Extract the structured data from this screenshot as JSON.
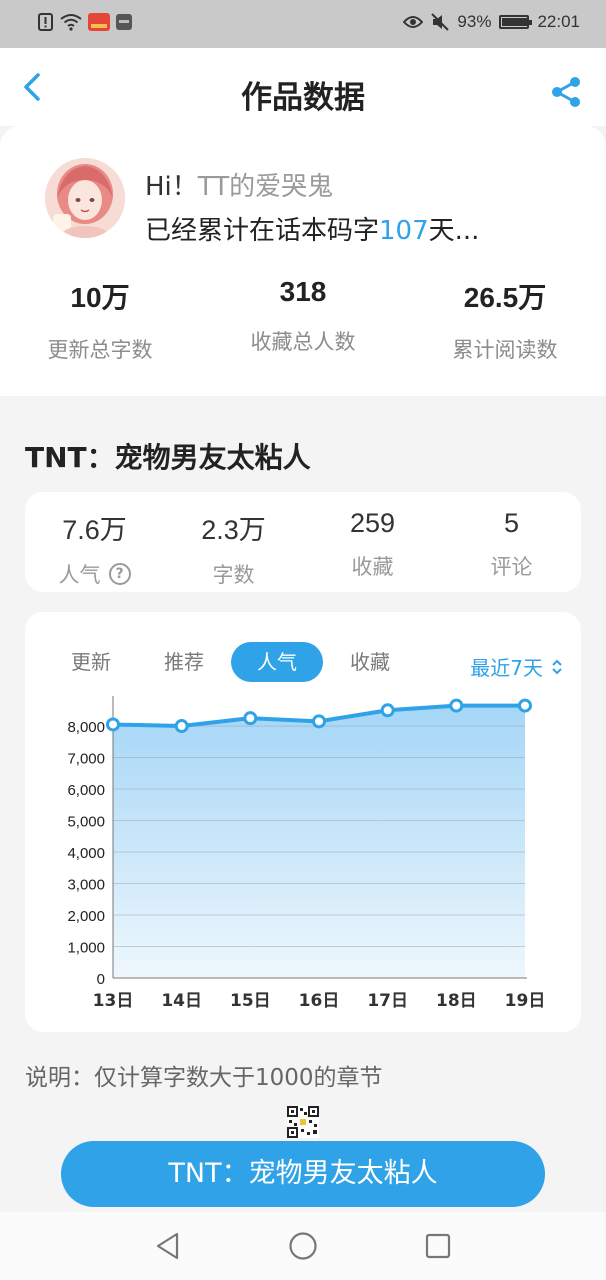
{
  "status_bar": {
    "battery_percent": "93%",
    "battery_level": 0.93,
    "time": "22:01"
  },
  "header": {
    "title": "作品数据",
    "back_icon": "chevron-left-icon",
    "share_icon": "share-icon"
  },
  "profile": {
    "greeting_prefix": "Hi！",
    "username": "TT的爱哭鬼",
    "streak_prefix": "已经累计在话本码字",
    "streak_days": "107",
    "streak_suffix": "天...",
    "stats": [
      {
        "value": "10万",
        "label": "更新总字数"
      },
      {
        "value": "318",
        "label": "收藏总人数"
      },
      {
        "value": "26.5万",
        "label": "累计阅读数"
      }
    ]
  },
  "work": {
    "title": "TNT：宠物男友太粘人",
    "metrics": [
      {
        "value": "7.6万",
        "label": "人气"
      },
      {
        "value": "2.3万",
        "label": "字数"
      },
      {
        "value": "259",
        "label": "收藏"
      },
      {
        "value": "5",
        "label": "评论"
      }
    ],
    "help_icon": "question-circle-icon"
  },
  "chart": {
    "tabs": [
      "更新",
      "推荐",
      "人气",
      "收藏"
    ],
    "active_tab": "人气",
    "range_label": "最近7天"
  },
  "chart_data": {
    "type": "area",
    "x": [
      "13日",
      "14日",
      "15日",
      "16日",
      "17日",
      "18日",
      "19日"
    ],
    "values": [
      8050,
      8000,
      8250,
      8150,
      8500,
      8650,
      8650
    ],
    "yticks": [
      0,
      1000,
      2000,
      3000,
      4000,
      5000,
      6000,
      7000,
      8000
    ],
    "ytick_labels": [
      "0",
      "1,000",
      "2,000",
      "3,000",
      "4,000",
      "5,000",
      "6,000",
      "7,000",
      "8,000"
    ],
    "ylim": [
      0,
      8700
    ],
    "grid": true,
    "color": "#2fa2e8"
  },
  "note": "说明：仅计算字数大于1000的章节",
  "bottom_button": "TNT：宠物男友太粘人",
  "colors": {
    "accent": "#2fa2e8",
    "muted": "#9a9a9a"
  }
}
